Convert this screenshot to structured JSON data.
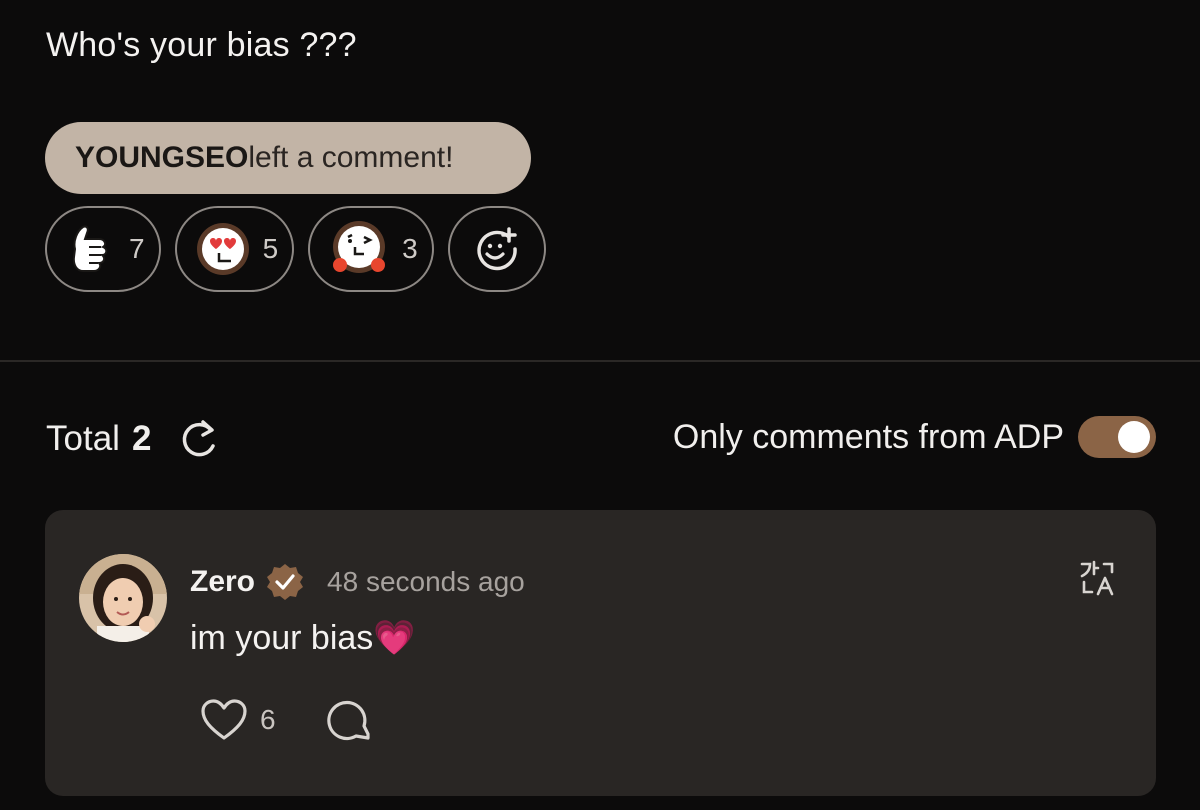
{
  "post": {
    "text": "Who's your bias ???"
  },
  "comment_pill": {
    "user": "YOUNGSEO",
    "message": "left a comment!"
  },
  "reactions": [
    {
      "icon": "thumbs-up-icon",
      "count": "7"
    },
    {
      "icon": "heart-eyes-emoji-icon",
      "count": "5"
    },
    {
      "icon": "wink-blush-emoji-icon",
      "count": "3"
    },
    {
      "icon": "add-reaction-icon"
    }
  ],
  "comments_header": {
    "total_label": "Total",
    "total_count": "2",
    "filter_label": "Only comments from ADP",
    "filter_on": true
  },
  "comment": {
    "author": "Zero",
    "time": "48 seconds ago",
    "text": "im your bias",
    "emoji": "💗",
    "likes": "6"
  },
  "colors": {
    "background": "#0c0b0b",
    "pill": "#c2b4a6",
    "toggle": "#8b6446",
    "card": "#292624",
    "verified_badge": "#8b6446"
  }
}
